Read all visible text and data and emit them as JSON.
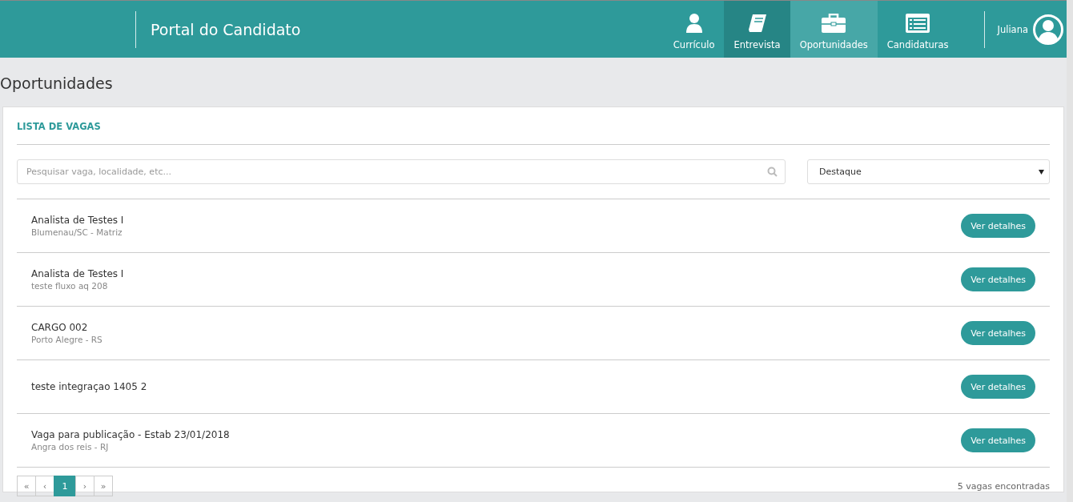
{
  "header": {
    "title": "Portal do Candidato",
    "nav": [
      {
        "label": "Currículo",
        "selected": false,
        "hovered": false
      },
      {
        "label": "Entrevista",
        "selected": false,
        "hovered": true
      },
      {
        "label": "Oportunidades",
        "selected": true,
        "hovered": false
      },
      {
        "label": "Candidaturas",
        "selected": false,
        "hovered": false
      }
    ],
    "user": "Juliana"
  },
  "page_title": "Oportunidades",
  "card": {
    "title": "LISTA DE VAGAS",
    "search": {
      "placeholder": "Pesquisar vaga, localidade, etc..."
    },
    "sort": {
      "value": "Destaque"
    },
    "jobs": [
      {
        "title": "Analista de Testes I",
        "location": "Blumenau/SC - Matriz",
        "button": "Ver detalhes"
      },
      {
        "title": "Analista de Testes I",
        "location": "teste fluxo aq 208",
        "button": "Ver detalhes"
      },
      {
        "title": "CARGO 002",
        "location": "Porto Alegre - RS",
        "button": "Ver detalhes"
      },
      {
        "title": "teste integraçao 1405 2",
        "button": "Ver detalhes"
      },
      {
        "title": "Vaga para publicação - Estab 23/01/2018",
        "location": "Angra dos reis - RJ",
        "button": "Ver detalhes"
      }
    ],
    "pagination": [
      {
        "label": "«",
        "selected": false
      },
      {
        "label": "‹",
        "selected": false
      },
      {
        "label": "1",
        "selected": true
      },
      {
        "label": "›",
        "selected": false
      },
      {
        "label": "»",
        "selected": false
      }
    ],
    "count": "5 vagas encontradas"
  }
}
